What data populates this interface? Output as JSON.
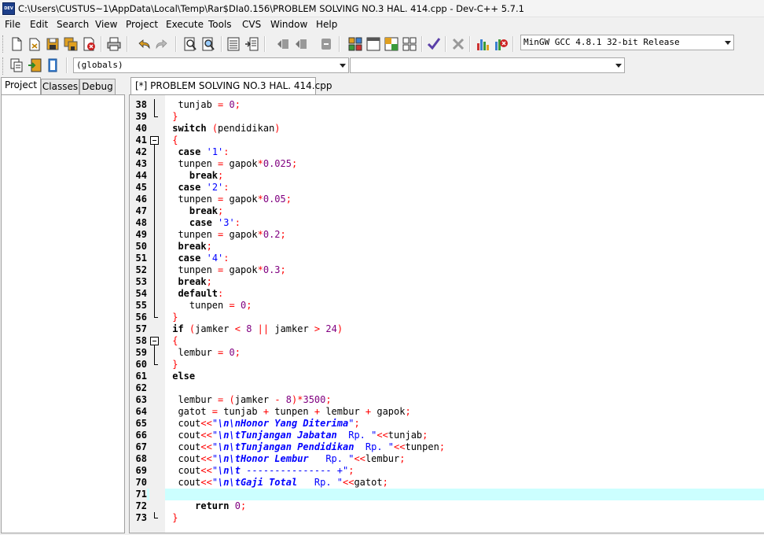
{
  "window": {
    "title": "C:\\Users\\CUSTUS~1\\AppData\\Local\\Temp\\Rar$DIa0.156\\PROBLEM SOLVING NO.3 HAL. 414.cpp - Dev-C++ 5.7.1",
    "icon": "devcpp-app-icon",
    "icon_text": "DEV"
  },
  "menu": {
    "items": [
      "File",
      "Edit",
      "Search",
      "View",
      "Project",
      "Execute",
      "Tools",
      "CVS",
      "Window",
      "Help"
    ]
  },
  "toolbar": {
    "compiler_select": "MinGW GCC 4.8.1 32-bit Release",
    "globals_select": "(globals)",
    "members_select": ""
  },
  "left_panel": {
    "tabs": [
      "Project",
      "Classes",
      "Debug"
    ],
    "active_tab": "Project"
  },
  "editor": {
    "tab_label": "[*] PROBLEM SOLVING NO.3 HAL. 414.cpp",
    "current_line": 71,
    "highlight_color": "#ccffff",
    "lines": [
      {
        "n": "38",
        "fold": "line",
        "tokens": [
          [
            "id",
            "  tunjab "
          ],
          [
            "op",
            "="
          ],
          [
            "id",
            " "
          ],
          [
            "num",
            "0"
          ],
          [
            "op",
            ";"
          ]
        ]
      },
      {
        "n": "39",
        "fold": "end",
        "tokens": [
          [
            "br",
            " }"
          ]
        ]
      },
      {
        "n": "40",
        "fold": "none",
        "tokens": [
          [
            "kw",
            " switch"
          ],
          [
            "id",
            " "
          ],
          [
            "op",
            "("
          ],
          [
            "id",
            "pendidikan"
          ],
          [
            "op",
            ")"
          ]
        ]
      },
      {
        "n": "41",
        "fold": "start",
        "tokens": [
          [
            "br",
            " {"
          ]
        ]
      },
      {
        "n": "42",
        "fold": "line",
        "tokens": [
          [
            "kw",
            "  case"
          ],
          [
            "id",
            " "
          ],
          [
            "str",
            "'1'"
          ],
          [
            "op",
            ":"
          ]
        ]
      },
      {
        "n": "43",
        "fold": "line",
        "tokens": [
          [
            "id",
            "  tunpen "
          ],
          [
            "op",
            "="
          ],
          [
            "id",
            " gapok"
          ],
          [
            "op",
            "*"
          ],
          [
            "num",
            "0.025"
          ],
          [
            "op",
            ";"
          ]
        ]
      },
      {
        "n": "44",
        "fold": "line",
        "tokens": [
          [
            "kw",
            "    break"
          ],
          [
            "op",
            ";"
          ]
        ]
      },
      {
        "n": "45",
        "fold": "line",
        "tokens": [
          [
            "kw",
            "  case"
          ],
          [
            "id",
            " "
          ],
          [
            "str",
            "'2'"
          ],
          [
            "op",
            ":"
          ]
        ]
      },
      {
        "n": "46",
        "fold": "line",
        "tokens": [
          [
            "id",
            "  tunpen "
          ],
          [
            "op",
            "="
          ],
          [
            "id",
            " gapok"
          ],
          [
            "op",
            "*"
          ],
          [
            "num",
            "0.05"
          ],
          [
            "op",
            ";"
          ]
        ]
      },
      {
        "n": "47",
        "fold": "line",
        "tokens": [
          [
            "kw",
            "    break"
          ],
          [
            "op",
            ";"
          ]
        ]
      },
      {
        "n": "48",
        "fold": "line",
        "tokens": [
          [
            "kw",
            "    case"
          ],
          [
            "id",
            " "
          ],
          [
            "str",
            "'3'"
          ],
          [
            "op",
            ":"
          ]
        ]
      },
      {
        "n": "49",
        "fold": "line",
        "tokens": [
          [
            "id",
            "  tunpen "
          ],
          [
            "op",
            "="
          ],
          [
            "id",
            " gapok"
          ],
          [
            "op",
            "*"
          ],
          [
            "num",
            "0.2"
          ],
          [
            "op",
            ";"
          ]
        ]
      },
      {
        "n": "50",
        "fold": "line",
        "tokens": [
          [
            "kw",
            "  break"
          ],
          [
            "op",
            ";"
          ]
        ]
      },
      {
        "n": "51",
        "fold": "line",
        "tokens": [
          [
            "kw",
            "  case"
          ],
          [
            "id",
            " "
          ],
          [
            "str",
            "'4'"
          ],
          [
            "op",
            ":"
          ]
        ]
      },
      {
        "n": "52",
        "fold": "line",
        "tokens": [
          [
            "id",
            "  tunpen "
          ],
          [
            "op",
            "="
          ],
          [
            "id",
            " gapok"
          ],
          [
            "op",
            "*"
          ],
          [
            "num",
            "0.3"
          ],
          [
            "op",
            ";"
          ]
        ]
      },
      {
        "n": "53",
        "fold": "line",
        "tokens": [
          [
            "kw",
            "  break"
          ],
          [
            "op",
            ";"
          ]
        ]
      },
      {
        "n": "54",
        "fold": "line",
        "tokens": [
          [
            "kw",
            "  default"
          ],
          [
            "op",
            ":"
          ]
        ]
      },
      {
        "n": "55",
        "fold": "line",
        "tokens": [
          [
            "id",
            "    tunpen "
          ],
          [
            "op",
            "="
          ],
          [
            "id",
            " "
          ],
          [
            "num",
            "0"
          ],
          [
            "op",
            ";"
          ]
        ]
      },
      {
        "n": "56",
        "fold": "end",
        "tokens": [
          [
            "br",
            " }"
          ]
        ]
      },
      {
        "n": "57",
        "fold": "none",
        "tokens": [
          [
            "kw",
            " if"
          ],
          [
            "id",
            " "
          ],
          [
            "op",
            "("
          ],
          [
            "id",
            "jamker "
          ],
          [
            "op",
            "<"
          ],
          [
            "id",
            " "
          ],
          [
            "num",
            "8"
          ],
          [
            "id",
            " "
          ],
          [
            "op",
            "||"
          ],
          [
            "id",
            " jamker "
          ],
          [
            "op",
            ">"
          ],
          [
            "id",
            " "
          ],
          [
            "num",
            "24"
          ],
          [
            "op",
            ")"
          ]
        ]
      },
      {
        "n": "58",
        "fold": "start",
        "tokens": [
          [
            "br",
            " {"
          ]
        ]
      },
      {
        "n": "59",
        "fold": "line",
        "tokens": [
          [
            "id",
            "  lembur "
          ],
          [
            "op",
            "="
          ],
          [
            "id",
            " "
          ],
          [
            "num",
            "0"
          ],
          [
            "op",
            ";"
          ]
        ]
      },
      {
        "n": "60",
        "fold": "end",
        "tokens": [
          [
            "br",
            " }"
          ]
        ]
      },
      {
        "n": "61",
        "fold": "none",
        "tokens": [
          [
            "kw",
            " else"
          ]
        ]
      },
      {
        "n": "62",
        "fold": "none",
        "tokens": []
      },
      {
        "n": "63",
        "fold": "none",
        "tokens": [
          [
            "id",
            "  lembur "
          ],
          [
            "op",
            "="
          ],
          [
            "id",
            " "
          ],
          [
            "op",
            "("
          ],
          [
            "id",
            "jamker "
          ],
          [
            "op",
            "-"
          ],
          [
            "id",
            " "
          ],
          [
            "num",
            "8"
          ],
          [
            "op",
            ")*"
          ],
          [
            "num",
            "3500"
          ],
          [
            "op",
            ";"
          ]
        ]
      },
      {
        "n": "64",
        "fold": "none",
        "tokens": [
          [
            "id",
            "  gatot "
          ],
          [
            "op",
            "="
          ],
          [
            "id",
            " tunjab "
          ],
          [
            "op",
            "+"
          ],
          [
            "id",
            " tunpen "
          ],
          [
            "op",
            "+"
          ],
          [
            "id",
            " lembur "
          ],
          [
            "op",
            "+"
          ],
          [
            "id",
            " gapok"
          ],
          [
            "op",
            ";"
          ]
        ]
      },
      {
        "n": "65",
        "fold": "none",
        "tokens": [
          [
            "id",
            "  cout"
          ],
          [
            "op",
            "<<"
          ],
          [
            "str",
            "\""
          ],
          [
            "esc",
            "\\n\\nHonor Yang Diterima"
          ],
          [
            "str",
            "\""
          ],
          [
            "op",
            ";"
          ]
        ]
      },
      {
        "n": "66",
        "fold": "none",
        "tokens": [
          [
            "id",
            "  cout"
          ],
          [
            "op",
            "<<"
          ],
          [
            "str",
            "\""
          ],
          [
            "esc",
            "\\n\\tTunjangan Jabatan"
          ],
          [
            "str",
            "  Rp. \""
          ],
          [
            "op",
            "<<"
          ],
          [
            "id",
            "tunjab"
          ],
          [
            "op",
            ";"
          ]
        ]
      },
      {
        "n": "67",
        "fold": "none",
        "tokens": [
          [
            "id",
            "  cout"
          ],
          [
            "op",
            "<<"
          ],
          [
            "str",
            "\""
          ],
          [
            "esc",
            "\\n\\tTunjangan Pendidikan"
          ],
          [
            "str",
            "  Rp. \""
          ],
          [
            "op",
            "<<"
          ],
          [
            "id",
            "tunpen"
          ],
          [
            "op",
            ";"
          ]
        ]
      },
      {
        "n": "68",
        "fold": "none",
        "tokens": [
          [
            "id",
            "  cout"
          ],
          [
            "op",
            "<<"
          ],
          [
            "str",
            "\""
          ],
          [
            "esc",
            "\\n\\tHonor Lembur"
          ],
          [
            "str",
            "   Rp. \""
          ],
          [
            "op",
            "<<"
          ],
          [
            "id",
            "lembur"
          ],
          [
            "op",
            ";"
          ]
        ]
      },
      {
        "n": "69",
        "fold": "none",
        "tokens": [
          [
            "id",
            "  cout"
          ],
          [
            "op",
            "<<"
          ],
          [
            "str",
            "\""
          ],
          [
            "esc",
            "\\n\\t"
          ],
          [
            "str",
            " --------------- +\""
          ],
          [
            "op",
            ";"
          ]
        ]
      },
      {
        "n": "70",
        "fold": "none",
        "tokens": [
          [
            "id",
            "  cout"
          ],
          [
            "op",
            "<<"
          ],
          [
            "str",
            "\""
          ],
          [
            "esc",
            "\\n\\tGaji Total"
          ],
          [
            "str",
            "   Rp. \""
          ],
          [
            "op",
            "<<"
          ],
          [
            "id",
            "gatot"
          ],
          [
            "op",
            ";"
          ]
        ]
      },
      {
        "n": "71",
        "fold": "none",
        "tokens": []
      },
      {
        "n": "72",
        "fold": "none",
        "tokens": [
          [
            "kw",
            "     return"
          ],
          [
            "id",
            " "
          ],
          [
            "num",
            "0"
          ],
          [
            "op",
            ";"
          ]
        ]
      },
      {
        "n": "73",
        "fold": "end",
        "tokens": [
          [
            "br",
            " }"
          ]
        ]
      }
    ]
  },
  "toolbar_icons": [
    "new-file-icon",
    "open-file-icon",
    "save-icon",
    "save-all-icon",
    "close-file-icon",
    "print-icon",
    "undo-icon",
    "redo-icon",
    "find-icon",
    "replace-icon",
    "goto-line-icon",
    "goto-function-icon",
    "indent-icon",
    "unindent-icon",
    "toggle-comment-icon",
    "layout-icon-1",
    "layout-icon-2",
    "layout-icon-3",
    "layout-icon-4",
    "check-syntax-icon",
    "stop-icon",
    "chart-icon",
    "profile-delete-icon",
    "new-class-icon",
    "insert-icon",
    "toggle-bookmark-icon"
  ]
}
